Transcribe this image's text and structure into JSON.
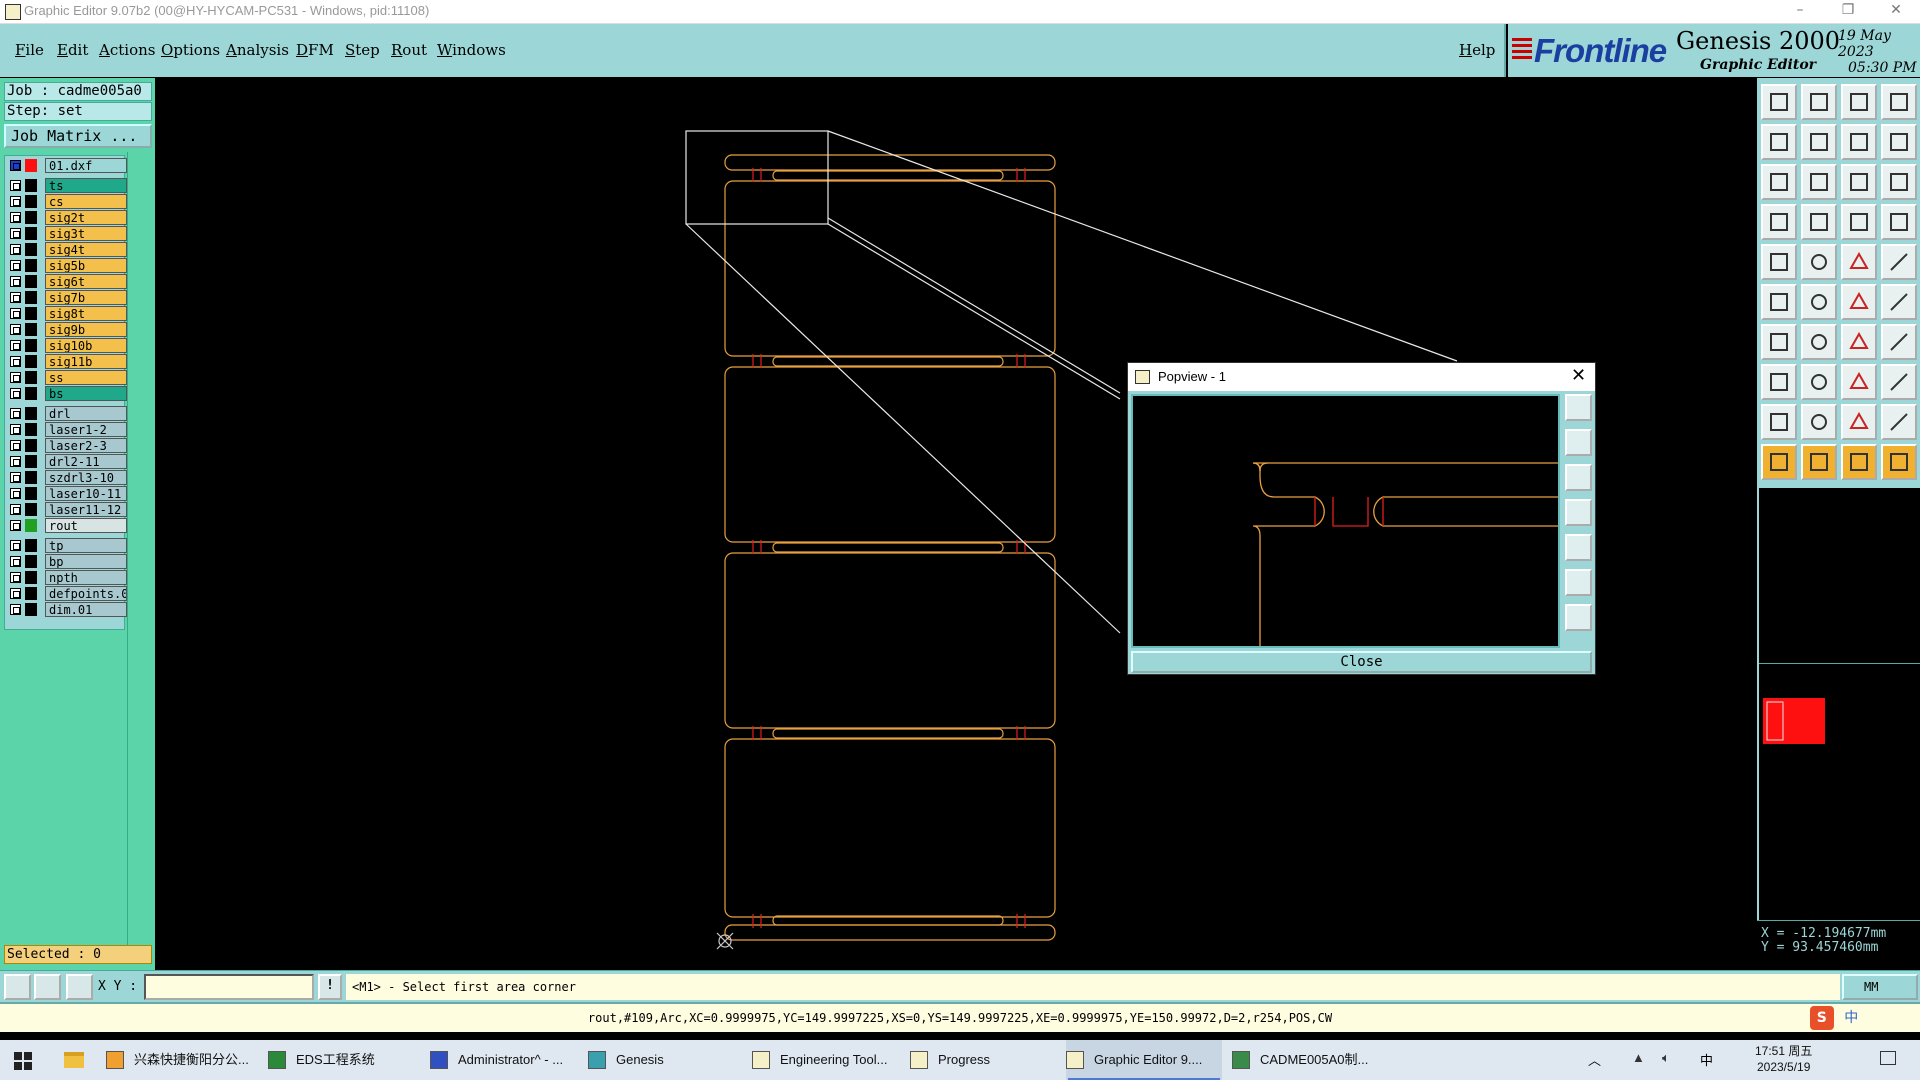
{
  "window": {
    "title": "Graphic Editor 9.07b2 (00@HY-HYCAM-PC531 - Windows, pid:11108)",
    "minimize": "–",
    "restore": "❐",
    "close": "✕"
  },
  "menu": {
    "items": [
      "File",
      "Edit",
      "Actions",
      "Options",
      "Analysis",
      "DFM",
      "Step",
      "Rout",
      "Windows"
    ],
    "help": "Help"
  },
  "brand": {
    "logo": "Frontline",
    "product": "Genesis 2000",
    "subtitle": "Graphic Editor",
    "date": "19 May 2023",
    "time": "05:30 PM"
  },
  "job": {
    "job_line": "Job : cadme005a0",
    "step_line": "Step: set",
    "matrix_button": "Job Matrix ..."
  },
  "layers": [
    {
      "name": "01.dxf",
      "bg": "#9cd6d6",
      "swatch": "#ff1010",
      "marker": "#1a3fd0"
    },
    {
      "name": "ts",
      "bg": "#1fa88a",
      "swatch": "#000000"
    },
    {
      "name": "cs",
      "bg": "#f4c04c",
      "swatch": "#000000"
    },
    {
      "name": "sig2t",
      "bg": "#f4c04c",
      "swatch": "#000000"
    },
    {
      "name": "sig3t",
      "bg": "#f4c04c",
      "swatch": "#000000"
    },
    {
      "name": "sig4t",
      "bg": "#f4c04c",
      "swatch": "#000000"
    },
    {
      "name": "sig5b",
      "bg": "#f4c04c",
      "swatch": "#000000"
    },
    {
      "name": "sig6t",
      "bg": "#f4c04c",
      "swatch": "#000000"
    },
    {
      "name": "sig7b",
      "bg": "#f4c04c",
      "swatch": "#000000"
    },
    {
      "name": "sig8t",
      "bg": "#f4c04c",
      "swatch": "#000000"
    },
    {
      "name": "sig9b",
      "bg": "#f4c04c",
      "swatch": "#000000"
    },
    {
      "name": "sig10b",
      "bg": "#f4c04c",
      "swatch": "#000000"
    },
    {
      "name": "sig11b",
      "bg": "#f4c04c",
      "swatch": "#000000"
    },
    {
      "name": "ss",
      "bg": "#f4c04c",
      "swatch": "#000000"
    },
    {
      "name": "bs",
      "bg": "#1fa88a",
      "swatch": "#000000"
    },
    {
      "name": "drl",
      "bg": "#a8c8d0",
      "swatch": "#000000"
    },
    {
      "name": "laser1-2",
      "bg": "#a8c8d0",
      "swatch": "#000000"
    },
    {
      "name": "laser2-3",
      "bg": "#a8c8d0",
      "swatch": "#000000"
    },
    {
      "name": "drl2-11",
      "bg": "#a8c8d0",
      "swatch": "#000000"
    },
    {
      "name": "szdrl3-10",
      "bg": "#a8c8d0",
      "swatch": "#000000"
    },
    {
      "name": "laser10-11",
      "bg": "#a8c8d0",
      "swatch": "#000000"
    },
    {
      "name": "laser11-12",
      "bg": "#a8c8d0",
      "swatch": "#000000"
    },
    {
      "name": "rout",
      "bg": "#d8e4e4",
      "swatch": "#22a022"
    },
    {
      "name": "tp",
      "bg": "#a8c8d0",
      "swatch": "#000000"
    },
    {
      "name": "bp",
      "bg": "#a8c8d0",
      "swatch": "#000000"
    },
    {
      "name": "npth",
      "bg": "#a8c8d0",
      "swatch": "#000000"
    },
    {
      "name": "defpoints.01",
      "bg": "#a8c8d0",
      "swatch": "#000000"
    },
    {
      "name": "dim.01",
      "bg": "#a8c8d0",
      "swatch": "#000000"
    }
  ],
  "selected": "Selected : 0",
  "popview": {
    "title": "Popview - 1",
    "close_x": "✕",
    "close_button": "Close"
  },
  "coords": {
    "x": "X = -12.194677mm",
    "y": "Y = 93.457460mm"
  },
  "command": {
    "xy_label": "X Y :",
    "xy_value": "",
    "info_button": "!",
    "prompt": "<M1> - Select first area corner",
    "units": "MM"
  },
  "status_line": "rout,#109,Arc,XC=0.9999975,YC=149.9997225,XS=0,YS=149.9997225,XE=0.9999975,YE=150.99972,D=2,r254,POS,CW",
  "ime": {
    "logo": "S",
    "lang": "中"
  },
  "colors": {
    "accent": "#9cd6d6",
    "panel_green": "#5ad4a8",
    "rout_orange": "#e8a040",
    "rout_red": "#e02020"
  },
  "taskbar": {
    "items": [
      {
        "label": "兴森快捷衡阳分公...",
        "icon": "browser-icon"
      },
      {
        "label": "EDS工程系统",
        "icon": "eds-icon"
      },
      {
        "label": "Administrator^ - ...",
        "icon": "floppy-icon"
      },
      {
        "label": "Genesis",
        "icon": "genesis-icon"
      },
      {
        "label": "Engineering Tool...",
        "icon": "app-x-icon"
      },
      {
        "label": "Progress",
        "icon": "app-x-icon"
      },
      {
        "label": "Graphic Editor 9....",
        "icon": "app-x-icon",
        "active": true
      },
      {
        "label": "CADME005A0制...",
        "icon": "document-icon"
      }
    ],
    "tray_lang": "中",
    "clock_time": "17:51 周五",
    "clock_date": "2023/5/19"
  }
}
